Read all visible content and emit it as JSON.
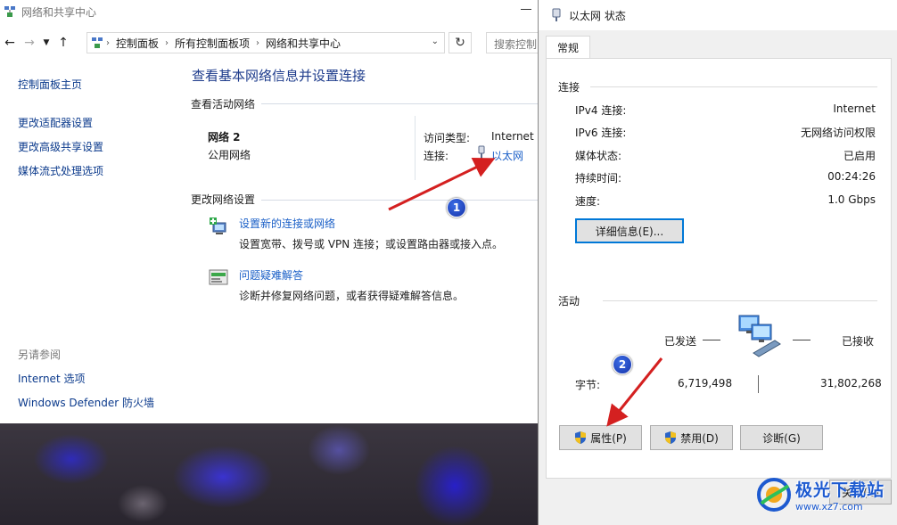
{
  "control_panel": {
    "title": "网络和共享中心",
    "breadcrumb": [
      "控制面板",
      "所有控制面板项",
      "网络和共享中心"
    ],
    "search_placeholder": "搜索控制",
    "left_nav": {
      "home": "控制面板主页",
      "links": [
        "更改适配器设置",
        "更改高级共享设置",
        "媒体流式处理选项"
      ]
    },
    "see_also": {
      "header": "另请参阅",
      "links": [
        "Internet 选项",
        "Windows Defender 防火墙"
      ]
    },
    "main_title": "查看基本网络信息并设置连接",
    "active_networks_header": "查看活动网络",
    "network": {
      "name": "网络 2",
      "kind": "公用网络",
      "access_type_label": "访问类型:",
      "access_type_value": "Internet",
      "connection_label": "连接:",
      "connection_value": "以太网"
    },
    "change_settings_header": "更改网络设置",
    "tasks": [
      {
        "title": "设置新的连接或网络",
        "desc": "设置宽带、拨号或 VPN 连接；或设置路由器或接入点。"
      },
      {
        "title": "问题疑难解答",
        "desc": "诊断并修复网络问题，或者获得疑难解答信息。"
      }
    ]
  },
  "status_dialog": {
    "title": "以太网 状态",
    "tab": "常规",
    "connection_group": "连接",
    "rows": [
      {
        "label": "IPv4 连接:",
        "value": "Internet"
      },
      {
        "label": "IPv6 连接:",
        "value": "无网络访问权限"
      },
      {
        "label": "媒体状态:",
        "value": "已启用"
      },
      {
        "label": "持续时间:",
        "value": "00:24:26"
      },
      {
        "label": "速度:",
        "value": "1.0 Gbps"
      }
    ],
    "details_button": "详细信息(E)...",
    "activity_group": "活动",
    "sent_label": "已发送",
    "received_label": "已接收",
    "bytes_label": "字节:",
    "bytes_sent": "6,719,498",
    "bytes_received": "31,802,268",
    "properties_button": "属性(P)",
    "disable_button": "禁用(D)",
    "diagnose_button": "诊断(G)",
    "close_button": "关闭(C)"
  },
  "annotations": {
    "step1": "1",
    "step2": "2"
  },
  "watermark": {
    "name": "极光下载站",
    "url": "www.xz7.com"
  },
  "colors": {
    "link": "#1a5fc7",
    "title": "#1e3c8c",
    "arrow": "#d42020",
    "badge": "#1f44c4"
  }
}
